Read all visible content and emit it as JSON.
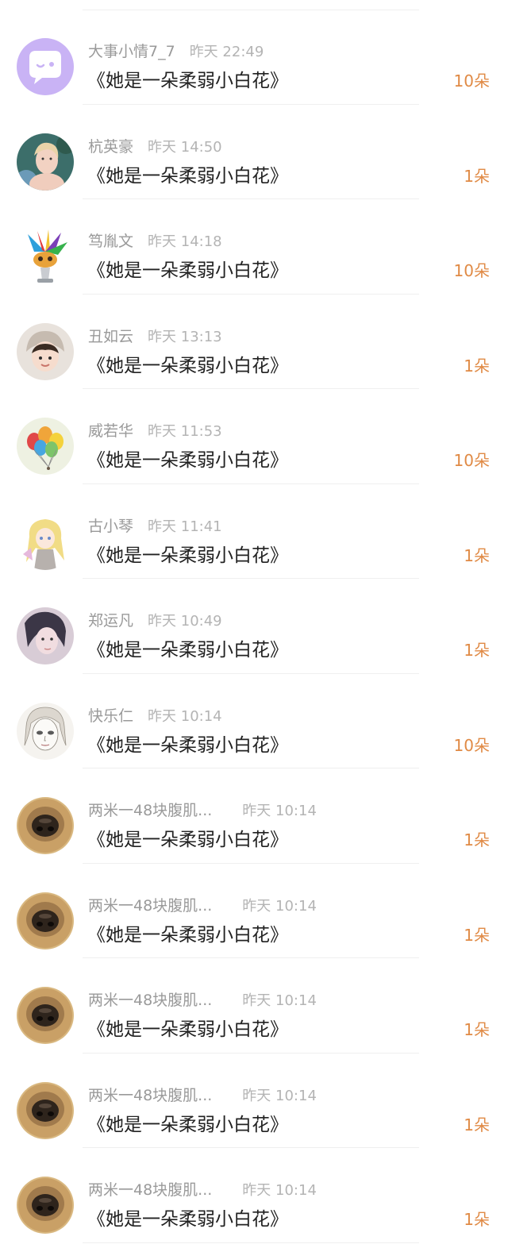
{
  "accent_color": "#e08a45",
  "items": [
    {
      "name": "大事小情7_7",
      "time": "昨天 22:49",
      "title": "《她是一朵柔弱小白花》",
      "gift": "10朵",
      "avatar": "chat-bubble-icon"
    },
    {
      "name": "杭英豪",
      "time": "昨天 14:50",
      "title": "《她是一朵柔弱小白花》",
      "gift": "1朵",
      "avatar": "girl-photo"
    },
    {
      "name": "笃胤文",
      "time": "昨天 14:18",
      "title": "《她是一朵柔弱小白花》",
      "gift": "10朵",
      "avatar": "feather-mask"
    },
    {
      "name": "丑如云",
      "time": "昨天 13:13",
      "title": "《她是一朵柔弱小白花》",
      "gift": "1朵",
      "avatar": "child-helmet-photo"
    },
    {
      "name": "威若华",
      "time": "昨天 11:53",
      "title": "《她是一朵柔弱小白花》",
      "gift": "10朵",
      "avatar": "balloons"
    },
    {
      "name": "古小琴",
      "time": "昨天 11:41",
      "title": "《她是一朵柔弱小白花》",
      "gift": "1朵",
      "avatar": "anime-girl"
    },
    {
      "name": "郑运凡",
      "time": "昨天 10:49",
      "title": "《她是一朵柔弱小白花》",
      "gift": "1朵",
      "avatar": "girl-photo-dark"
    },
    {
      "name": "快乐仁",
      "time": "昨天 10:14",
      "title": "《她是一朵柔弱小白花》",
      "gift": "10朵",
      "avatar": "sketch-face"
    },
    {
      "name": "两米一48块腹肌...",
      "time": "昨天 10:14",
      "title": "《她是一朵柔弱小白花》",
      "gift": "1朵",
      "avatar": "dog-nose"
    },
    {
      "name": "两米一48块腹肌...",
      "time": "昨天 10:14",
      "title": "《她是一朵柔弱小白花》",
      "gift": "1朵",
      "avatar": "dog-nose"
    },
    {
      "name": "两米一48块腹肌...",
      "time": "昨天 10:14",
      "title": "《她是一朵柔弱小白花》",
      "gift": "1朵",
      "avatar": "dog-nose"
    },
    {
      "name": "两米一48块腹肌...",
      "time": "昨天 10:14",
      "title": "《她是一朵柔弱小白花》",
      "gift": "1朵",
      "avatar": "dog-nose"
    },
    {
      "name": "两米一48块腹肌...",
      "time": "昨天 10:14",
      "title": "《她是一朵柔弱小白花》",
      "gift": "1朵",
      "avatar": "dog-nose"
    }
  ]
}
